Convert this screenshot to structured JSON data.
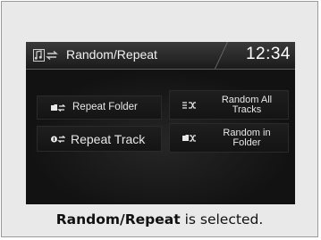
{
  "header": {
    "title": "Random/Repeat",
    "clock": "12:34",
    "icon": "music-repeat-icon"
  },
  "buttons": {
    "repeat_folder": {
      "label": "Repeat Folder",
      "icon": "folder-repeat-icon"
    },
    "random_all_tracks": {
      "line1": "Random All",
      "line2": "Tracks",
      "icon": "shuffle-all-icon"
    },
    "repeat_track": {
      "label": "Repeat Track",
      "icon": "track-repeat-icon"
    },
    "random_in_folder": {
      "line1": "Random in",
      "line2": "Folder",
      "icon": "folder-shuffle-icon"
    }
  },
  "caption": {
    "bold": "Random/Repeat",
    "rest": " is selected."
  },
  "colors": {
    "screen_bg": "#0f0f0f",
    "text": "#e8e8e8",
    "frame_bg": "#e9e9e9"
  }
}
